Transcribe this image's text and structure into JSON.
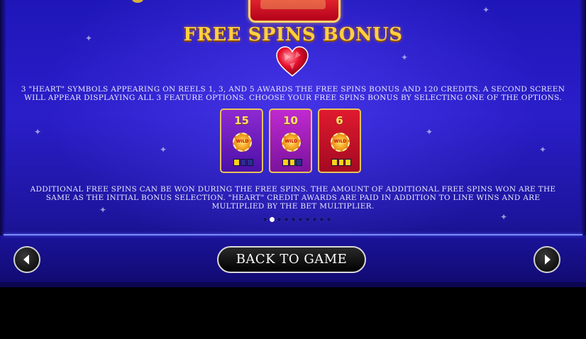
{
  "header": {
    "title": "FREE SPINS BONUS",
    "heart_icon": "heart-icon"
  },
  "content": {
    "paragraph_1": "3 \"HEART\" SYMBOLS APPEARING ON REELS 1, 3, AND 5 AWARDS THE FREE SPINS BONUS AND 120 CREDITS. A SECOND SCREEN WILL APPEAR DISPLAYING ALL 3 FEATURE OPTIONS. CHOOSE YOUR FREE SPINS BONUS BY SELECTING ONE OF THE OPTIONS.",
    "paragraph_2": "ADDITIONAL FREE SPINS CAN BE WON DURING THE FREE SPINS. THE AMOUNT OF ADDITIONAL FREE SPINS WON ARE THE SAME AS THE INITIAL BONUS SELECTION. \"HEART\" CREDIT AWARDS ARE PAID IN ADDITION TO LINE WINS AND ARE MULTIPLIED BY THE BET MULTIPLIER."
  },
  "options": [
    {
      "spins": "15",
      "chip_label": "WILD",
      "meter_filled": 1,
      "meter_total": 3
    },
    {
      "spins": "10",
      "chip_label": "WILD",
      "meter_filled": 2,
      "meter_total": 3
    },
    {
      "spins": "6",
      "chip_label": "WILD",
      "meter_filled": 3,
      "meter_total": 3
    }
  ],
  "pagination": {
    "total": 10,
    "current": 2
  },
  "footer": {
    "back_label": "BACK TO GAME",
    "prev_icon": "arrow-left-icon",
    "next_icon": "arrow-right-icon"
  },
  "colors": {
    "title": "#ffd040",
    "accent_border": "#e8c25a",
    "background": "#2a1ec9"
  }
}
